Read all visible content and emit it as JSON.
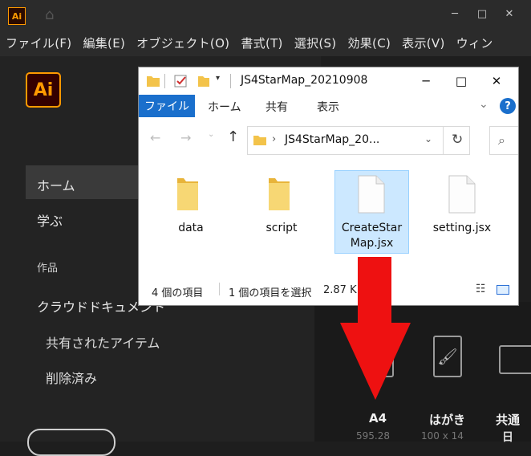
{
  "illustrator": {
    "logo_text": "Ai",
    "window_controls": [
      "─",
      "□",
      "✕"
    ],
    "menu": [
      "ファイル(F)",
      "編集(E)",
      "オブジェクト(O)",
      "書式(T)",
      "選択(S)",
      "効果(C)",
      "表示(V)",
      "ウィン"
    ],
    "sidebar": {
      "home": "ホーム",
      "learn": "学ぶ",
      "works_heading": "作品",
      "cloud_docs": "クラウドドキュメント",
      "shared_items": "共有されたアイテム",
      "deleted": "削除済み"
    },
    "presets": [
      {
        "label": "A4",
        "sub": "595.28"
      },
      {
        "label": "はがき",
        "sub": "100 x 14"
      },
      {
        "label": "共通",
        "sub": "日"
      }
    ]
  },
  "explorer": {
    "title": "JS4StarMap_20210908",
    "tabs": {
      "file": "ファイル",
      "home": "ホーム",
      "share": "共有",
      "view": "表示"
    },
    "address": "JS4StarMap_20...",
    "items": [
      {
        "name": "data",
        "type": "folder"
      },
      {
        "name": "script",
        "type": "folder"
      },
      {
        "name": "CreateStarMap.jsx",
        "line1": "CreateStar",
        "line2": "Map.jsx",
        "type": "file",
        "selected": true
      },
      {
        "name": "setting.jsx",
        "type": "file"
      }
    ],
    "status": {
      "count": "4 個の項目",
      "selection": "1 個の項目を選択",
      "size": "2.87 K"
    }
  },
  "colors": {
    "arrow": "#ee1111",
    "ribbon_file_tab": "#1a6fcc",
    "ai_orange": "#ff9a00",
    "selection": "#cce8ff"
  }
}
